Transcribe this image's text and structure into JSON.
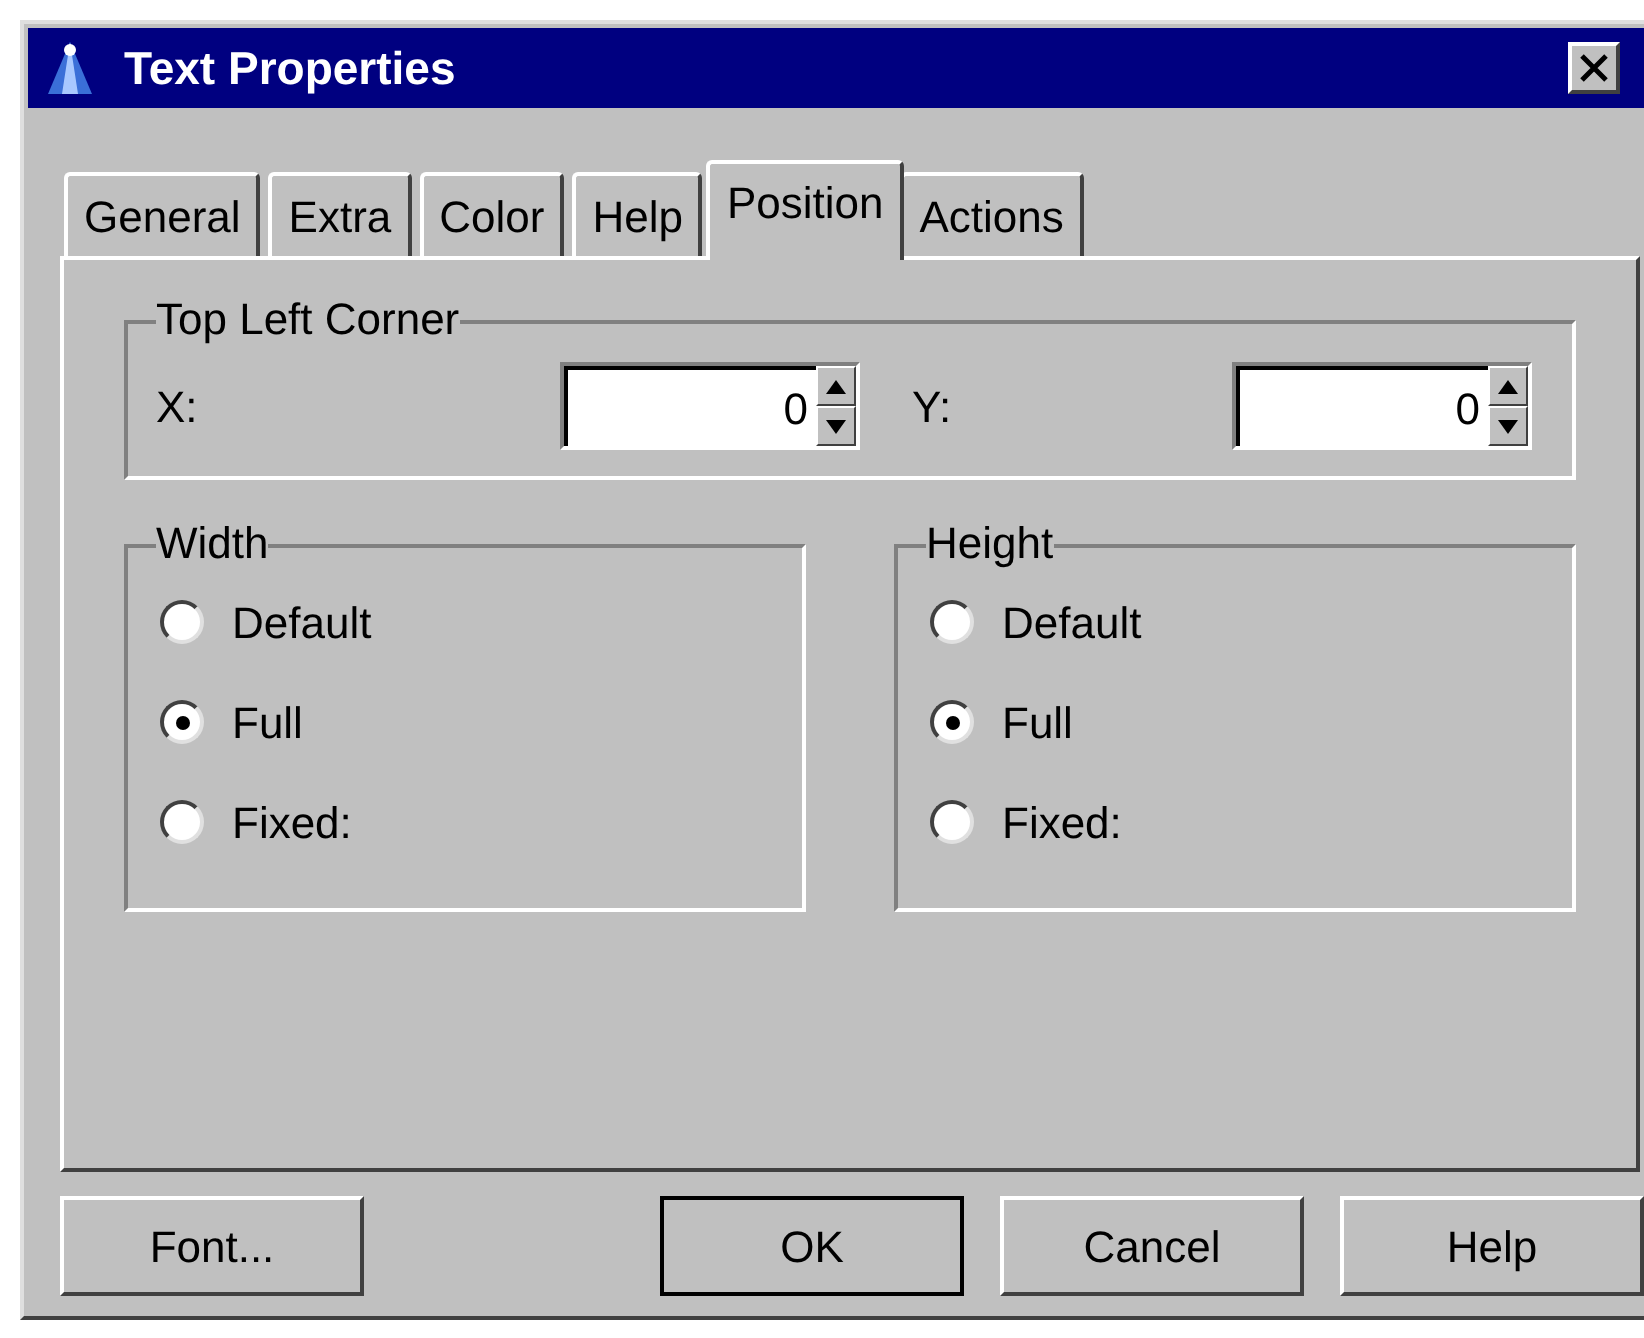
{
  "window": {
    "title": "Text Properties"
  },
  "tabs": [
    {
      "label": "General",
      "selected": false
    },
    {
      "label": "Extra",
      "selected": false
    },
    {
      "label": "Color",
      "selected": false
    },
    {
      "label": "Help",
      "selected": false
    },
    {
      "label": "Position",
      "selected": true
    },
    {
      "label": "Actions",
      "selected": false
    }
  ],
  "top_left_corner": {
    "title": "Top Left Corner",
    "fields": [
      {
        "label": "X:",
        "value": "0"
      },
      {
        "label": "Y:",
        "value": "0"
      }
    ]
  },
  "radio_groups": [
    {
      "title": "Width",
      "options": [
        {
          "label": "Default",
          "selected": false
        },
        {
          "label": "Full",
          "selected": true
        },
        {
          "label": "Fixed:",
          "selected": false
        }
      ]
    },
    {
      "title": "Height",
      "options": [
        {
          "label": "Default",
          "selected": false
        },
        {
          "label": "Full",
          "selected": true
        },
        {
          "label": "Fixed:",
          "selected": false
        }
      ]
    }
  ],
  "buttons": [
    {
      "label": "Font...",
      "default": false
    },
    {
      "label": "OK",
      "default": true
    },
    {
      "label": "Cancel",
      "default": false
    },
    {
      "label": "Help",
      "default": false
    }
  ]
}
